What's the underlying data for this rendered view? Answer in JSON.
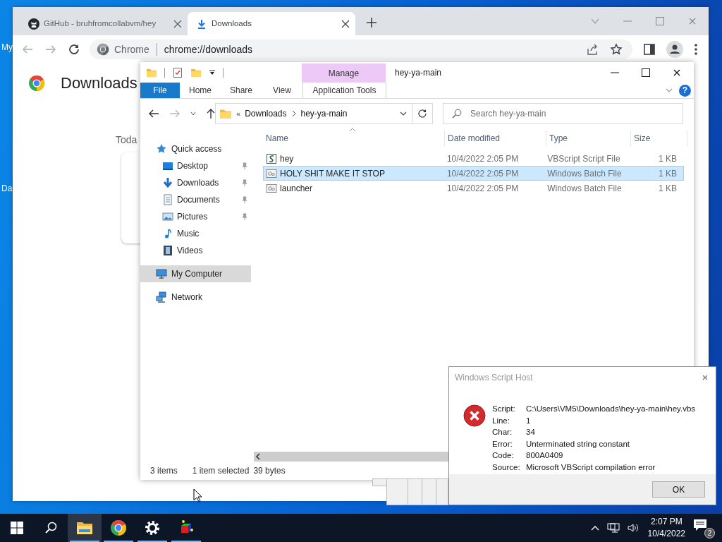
{
  "desktop": {
    "icon_labels": [
      "My",
      "Da"
    ]
  },
  "browser": {
    "tabs": [
      {
        "title": "GitHub - bruhfromcollabvm/hey",
        "kind": "site",
        "selected": false
      },
      {
        "title": "Downloads",
        "kind": "download",
        "selected": true
      }
    ],
    "omnibox": {
      "site": "Chrome",
      "url": "chrome://downloads"
    },
    "page": {
      "title": "Downloads",
      "section": "Toda"
    }
  },
  "explorer": {
    "title": "hey-ya-main",
    "ribbon_tabs": [
      {
        "label": "File",
        "kind": "file"
      },
      {
        "label": "Home",
        "kind": "tab"
      },
      {
        "label": "Share",
        "kind": "tab"
      },
      {
        "label": "View",
        "kind": "tab"
      },
      {
        "label": "Application Tools",
        "kind": "context",
        "context_label": "Manage"
      }
    ],
    "help": "?",
    "address": {
      "overflow": "«",
      "path": [
        "Downloads",
        "hey-ya-main"
      ]
    },
    "search": {
      "placeholder": "Search hey-ya-main"
    },
    "nav": [
      {
        "label": "Quick access",
        "kind": "star",
        "selected": false,
        "children": [
          {
            "label": "Desktop",
            "kind": "desktop",
            "pinned": true
          },
          {
            "label": "Downloads",
            "kind": "download",
            "pinned": true
          },
          {
            "label": "Documents",
            "kind": "documents",
            "pinned": true
          },
          {
            "label": "Pictures",
            "kind": "pictures",
            "pinned": true
          },
          {
            "label": "Music",
            "kind": "music",
            "pinned": false
          },
          {
            "label": "Videos",
            "kind": "videos",
            "pinned": false
          }
        ]
      },
      {
        "label": "My Computer",
        "kind": "computer",
        "selected": true
      },
      {
        "label": "Network",
        "kind": "network",
        "selected": false
      }
    ],
    "columns": [
      "Name",
      "Date modified",
      "Type",
      "Size"
    ],
    "files": [
      {
        "name": "hey",
        "date": "10/4/2022 2:05 PM",
        "type": "VBScript Script File",
        "size": "1 KB",
        "kind": "script",
        "selected": false
      },
      {
        "name": "HOLY SHIT MAKE IT STOP",
        "date": "10/4/2022 2:05 PM",
        "type": "Windows Batch File",
        "size": "1 KB",
        "kind": "batch",
        "selected": true
      },
      {
        "name": "launcher",
        "date": "10/4/2022 2:05 PM",
        "type": "Windows Batch File",
        "size": "1 KB",
        "kind": "batch",
        "selected": false
      }
    ],
    "status": {
      "count": "3 items",
      "selection": "1 item selected",
      "size": "39 bytes"
    }
  },
  "dialog": {
    "title": "Windows Script Host",
    "fields": [
      {
        "label": "Script:",
        "value": "C:\\Users\\VM5\\Downloads\\hey-ya-main\\hey.vbs"
      },
      {
        "label": "Line:",
        "value": "1"
      },
      {
        "label": "Char:",
        "value": "34"
      },
      {
        "label": "Error:",
        "value": "Unterminated string constant"
      },
      {
        "label": "Code:",
        "value": "800A0409"
      },
      {
        "label": "Source:",
        "value": "Microsoft VBScript compilation error"
      }
    ],
    "button": "OK"
  },
  "taskbar": {
    "apps": [
      {
        "kind": "explorer",
        "selected": true
      },
      {
        "kind": "chrome",
        "selected": false
      },
      {
        "kind": "settings",
        "selected": false
      },
      {
        "kind": "cube",
        "selected": false
      }
    ],
    "time": "2:07 PM",
    "date": "10/4/2022",
    "notifications": "2"
  }
}
